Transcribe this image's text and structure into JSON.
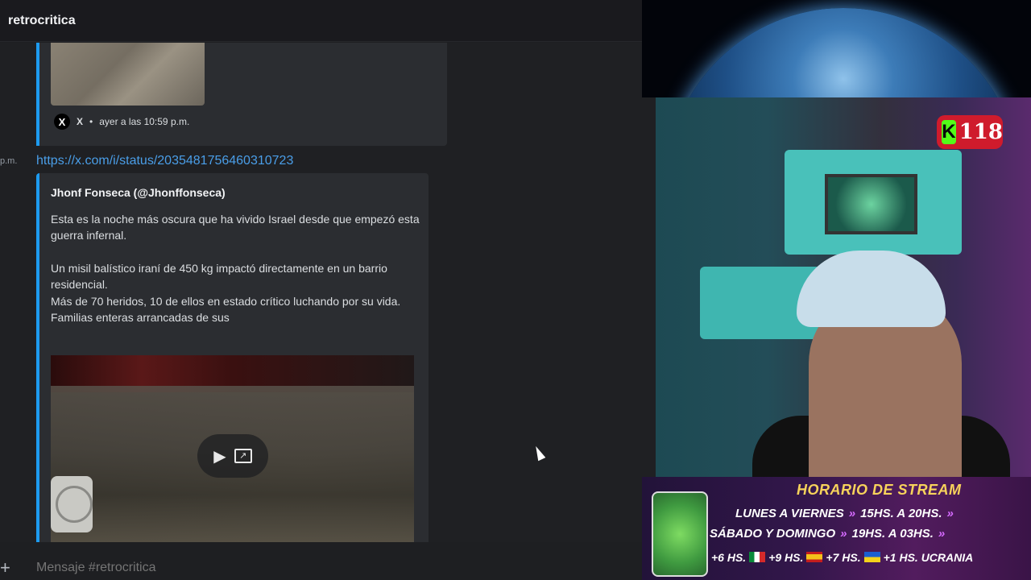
{
  "channel": {
    "title": "retrocritica"
  },
  "embed1": {
    "source": "X",
    "timestamp": "ayer a las 10:59 p.m."
  },
  "message": {
    "time_fragment": "p.m.",
    "link": "https://x.com/i/status/2035481756460310723"
  },
  "embed2": {
    "author": "Jhonf Fonseca (@Jhonffonseca)",
    "description_lines": [
      "Esta es la noche más oscura que ha vivido Israel desde que empezó esta guerra infernal.",
      "Un misil balístico iraní de 450 kg impactó directamente en un barrio residencial.",
      "Más de 70 heridos, 10 de ellos en estado crítico luchando por su vida.",
      "Familias enteras arrancadas de sus"
    ]
  },
  "composer": {
    "placeholder": "Mensaje #retrocritica"
  },
  "stream": {
    "kick_count": "118",
    "banner_title": "HORARIO DE STREAM",
    "weekdays": "LUNES A VIERNES",
    "weekdays_time": "15HS. A 20HS.",
    "weekend": "SÁBADO Y DOMINGO",
    "weekend_time": "19HS. A 03HS.",
    "tz_mx": "+6 HS.",
    "tz_es": "+9 HS.",
    "tz_ua": "+7 HS.",
    "tz_extra": "+1 HS. UCRANIA"
  },
  "colors": {
    "accent_link": "#4a9ee8",
    "embed_bar": "#1d9bf0",
    "kick_red": "#cf1b2c",
    "kick_green": "#53fc18"
  }
}
